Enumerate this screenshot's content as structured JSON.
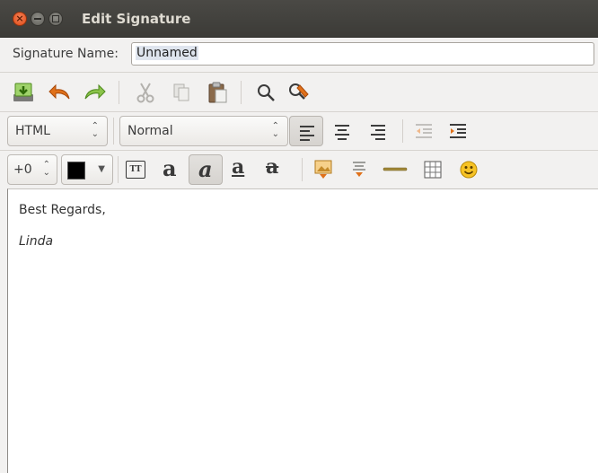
{
  "window": {
    "title": "Edit Signature",
    "controls": {
      "close_glyph": "×"
    }
  },
  "name_row": {
    "label": "Signature Name:",
    "value": "Unnamed"
  },
  "toolbar1": {
    "icons": [
      "save-icon",
      "undo-icon",
      "redo-icon",
      "cut-icon",
      "copy-icon",
      "paste-icon",
      "find-icon",
      "find-replace-icon"
    ]
  },
  "toolbar2": {
    "mode_value": "HTML",
    "paragraph_style_value": "Normal",
    "alignment_selected": "left"
  },
  "toolbar3": {
    "font_size_value": "+0",
    "text_color": "#000000",
    "teletype_label": "TT",
    "bold_glyph": "a",
    "italic_glyph": "a",
    "underline_glyph": "a",
    "strike_glyph": "a",
    "italic_active": true
  },
  "editor": {
    "lines": [
      "Best Regards,",
      "Linda"
    ]
  },
  "colors": {
    "titlebar": "#3c3b37",
    "close_button": "#df4a16",
    "accent_orange": "#e0711a"
  }
}
